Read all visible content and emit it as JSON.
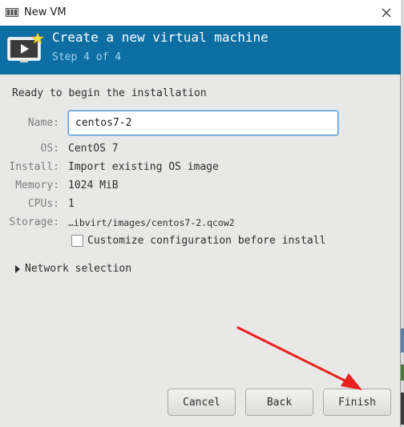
{
  "window": {
    "title": "New VM"
  },
  "banner": {
    "title": "Create a new virtual machine",
    "step": "Step 4 of 4"
  },
  "main": {
    "heading": "Ready to begin the installation",
    "name": {
      "label": "Name:",
      "value": "centos7-2"
    },
    "details": [
      {
        "label": "OS:",
        "value": "CentOS 7"
      },
      {
        "label": "Install:",
        "value": "Import existing OS image"
      },
      {
        "label": "Memory:",
        "value": "1024 MiB"
      },
      {
        "label": "CPUs:",
        "value": "1"
      },
      {
        "label": "Storage:",
        "value": "…ibvirt/images/centos7-2.qcow2"
      }
    ],
    "customize_checkbox": {
      "label": "Customize configuration before install",
      "checked": false
    },
    "network_expander": {
      "label": "Network selection",
      "expanded": false
    }
  },
  "buttons": {
    "cancel": "Cancel",
    "back": "Back",
    "finish": "Finish"
  },
  "icons": {
    "app": "vm-manager-icon",
    "close": "close-icon",
    "banner": "new-vm-icon"
  },
  "colors": {
    "banner_bg": "#0d6ea4",
    "step_text": "#9fd3f2",
    "annotation_arrow": "#e8231f"
  }
}
